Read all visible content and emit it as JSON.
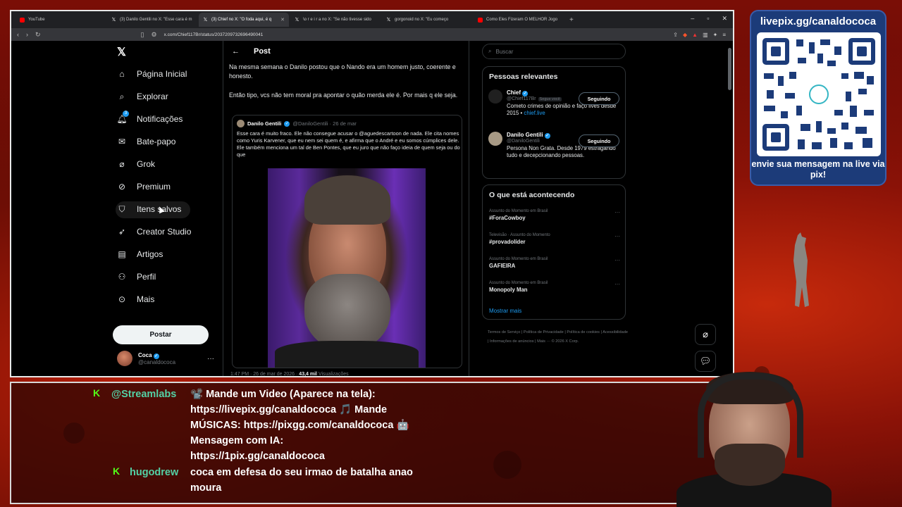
{
  "browser": {
    "tabs": [
      {
        "label": "YouTube",
        "icon": "youtube-icon"
      },
      {
        "label": "(3) Danilo Gentili no X: \"Esse cara é m",
        "icon": "x-icon"
      },
      {
        "label": "(3) Chief no X: \"O foda aqui, é q",
        "icon": "x-icon"
      },
      {
        "label": "\\o r e i r a no X: \"Se não tivesse sido",
        "icon": "x-icon"
      },
      {
        "label": "gorgonoid no X: \"Eu começo",
        "icon": "x-icon"
      },
      {
        "label": "Como Eles Fizeram O MELHOR Jogo",
        "icon": "youtube-icon"
      }
    ],
    "url": "x.com/Chief117Br/status/2037209732696490041"
  },
  "nav": {
    "items": [
      "Página Inicial",
      "Explorar",
      "Notificações",
      "Bate-papo",
      "Grok",
      "Premium",
      "Itens salvos",
      "Creator Studio",
      "Artigos",
      "Perfil",
      "Mais"
    ],
    "notif_badge": "3",
    "post_label": "Postar",
    "account_name": "Coca",
    "account_handle": "@canaldococa"
  },
  "post": {
    "header": "Post",
    "text1": "Na mesma semana o Danilo postou que o Nando era um homem justo, coerente e honesto.",
    "text2": "Então tipo, vcs não tem moral pra apontar o quão merda ele é. Por mais q ele seja.",
    "quote": {
      "name": "Danilo Gentili",
      "handle": "@DaniloGentili · 26 de mar",
      "text": "Esse cara é muito fraco. Ele não consegue acusar o @aguedescartoon de nada. Ele cita nomes como Yuris Karvener, que eu nem sei quem é, e afirma que o André e eu somos cúmplices dele. Ele também menciona um tal de Ben Pontes, que eu juro que não faço ideia de quem seja ou do que"
    },
    "meta_time": "1:47 PM · 26 de mar de 2026 ·",
    "meta_views": "43,4 mil",
    "meta_views_label": "Visualizações"
  },
  "right": {
    "search_placeholder": "Buscar",
    "relevant_title": "Pessoas relevantes",
    "people": [
      {
        "name": "Chief",
        "handle": "@Chief117Br",
        "follows_you": "Segue você",
        "bio": "Cometo crimes de opinião e faço lives desde 2015 •",
        "link": "chief.live",
        "button": "Seguindo"
      },
      {
        "name": "Danilo Gentili",
        "handle": "@DaniloGentili",
        "bio": "Persona Non Grata. Desde 1979 estragando tudo e decepcionando pessoas.",
        "button": "Seguindo"
      }
    ],
    "happening_title": "O que está acontecendo",
    "trends": [
      {
        "context": "Assunto do Momento em Brasil",
        "name": "#ForaCowboy"
      },
      {
        "context": "Televisão · Assunto do Momento",
        "name": "#provadolíder"
      },
      {
        "context": "Assunto do Momento em Brasil",
        "name": "GAFIEIRA"
      },
      {
        "context": "Assunto do Momento em Brasil",
        "name": "Monopoly Man"
      }
    ],
    "show_more": "Mostrar mais",
    "footer": "Termos de Serviço  |  Política de Privacidade  |  Política de cookies  |  Acessibilidade  |  Informações de anúncios  |  Mais ···  © 2026 X Corp."
  },
  "overlay": {
    "qr_title": "livepix.gg/canaldococa",
    "qr_caption": "envie sua mensagem na live via pix!"
  },
  "chat": {
    "messages": [
      {
        "user": "@Streamlabs",
        "lines": [
          "📽️ Mande um Video (Aparece na tela):",
          "https://livepix.gg/canaldococa 🎵 Mande",
          "MÚSICAS: https://pixgg.com/canaldococa 🤖",
          "Mensagem com IA:",
          "https://1pix.gg/canaldococa"
        ]
      },
      {
        "user": "hugodrew",
        "lines": [
          "coca em defesa do seu irmao de batalha anao",
          "moura"
        ]
      }
    ],
    "badge": "K"
  },
  "colors": {
    "accent": "#1d9bf0",
    "kick_green": "#53fc18",
    "bg": "#000000"
  }
}
